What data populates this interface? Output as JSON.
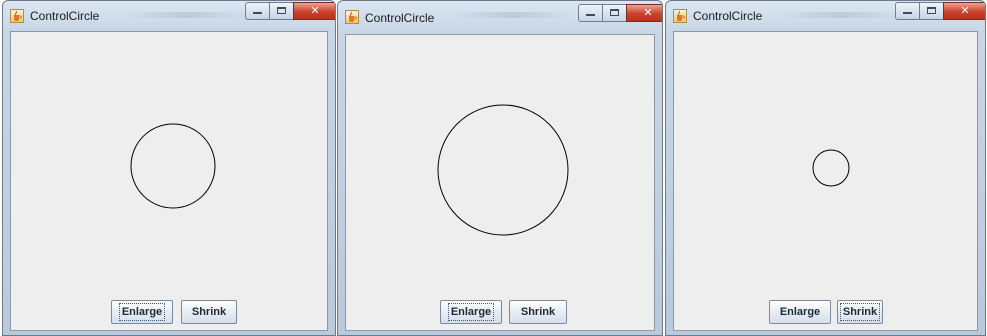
{
  "windows": [
    {
      "title": "ControlCircle",
      "radius_px": 42,
      "buttons": {
        "enlarge": "Enlarge",
        "shrink": "Shrink"
      },
      "focused_button": "enlarge"
    },
    {
      "title": "ControlCircle",
      "radius_px": 65,
      "buttons": {
        "enlarge": "Enlarge",
        "shrink": "Shrink"
      },
      "focused_button": "enlarge"
    },
    {
      "title": "ControlCircle",
      "radius_px": 18,
      "buttons": {
        "enlarge": "Enlarge",
        "shrink": "Shrink"
      },
      "focused_button": "shrink"
    }
  ],
  "icons": {
    "app": "java-cup-icon",
    "minimize": "minimize-icon",
    "maximize": "maximize-icon",
    "close": "close-icon"
  },
  "colors": {
    "panel": "#eeeeee",
    "circle_stroke": "#000000",
    "close_button": "#c9412a"
  }
}
